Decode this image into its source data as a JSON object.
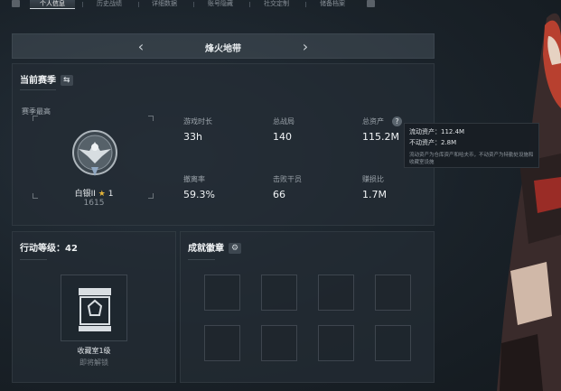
{
  "tabs": [
    {
      "label": "个人信息",
      "active": true
    },
    {
      "label": "历史战绩",
      "active": false
    },
    {
      "label": "详细数据",
      "active": false
    },
    {
      "label": "账号隐藏",
      "active": false
    },
    {
      "label": "社交定制",
      "active": false
    },
    {
      "label": "储备档案",
      "active": false
    }
  ],
  "map": {
    "title": "烽火地带",
    "prev": "‹",
    "next": "›"
  },
  "season": {
    "title": "当前赛季",
    "subtitle": "赛季最高",
    "rank_name": "白银II",
    "rank_level": "1",
    "rank_score": "1615",
    "stats": {
      "playtime": {
        "label": "游戏时长",
        "value": "33h"
      },
      "matches": {
        "label": "总战局",
        "value": "140"
      },
      "assets": {
        "label": "总资产",
        "value": "115.2M"
      },
      "extract": {
        "label": "撤离率",
        "value": "59.3%"
      },
      "kills": {
        "label": "击败干员",
        "value": "66"
      },
      "ratio": {
        "label": "赚损比",
        "value": "1.7M"
      }
    }
  },
  "tooltip": {
    "liquid": "流动资产：112.4M",
    "fixed": "不动资产：2.8M",
    "desc": "流动资产为仓库资产和哈夫币，不动资产为特勤处设施和收藏室设施"
  },
  "action_level": {
    "title": "行动等级：42",
    "vault_name": "收藏室1级",
    "vault_status": "即将解锁"
  },
  "badges": {
    "title": "成就徽章"
  },
  "colors": {
    "accent_gold": "#e5b53a",
    "panel_bg": "#242d35",
    "text_primary": "#f0f3f5",
    "text_muted": "#9aa2a9"
  },
  "icons": {
    "swap": "swap-icon",
    "gear": "gear-icon",
    "help": "help-icon"
  }
}
